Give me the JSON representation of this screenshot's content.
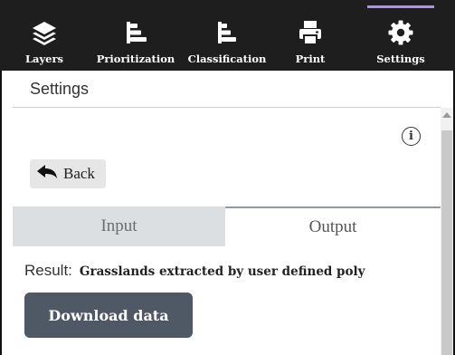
{
  "toolbar": {
    "items": [
      {
        "label": "Layers",
        "icon": "layers-icon"
      },
      {
        "label": "Prioritization",
        "icon": "prioritization-icon"
      },
      {
        "label": "Classification",
        "icon": "classification-icon"
      },
      {
        "label": "Print",
        "icon": "printer-icon"
      },
      {
        "label": "Settings",
        "icon": "gear-icon",
        "active": true
      }
    ],
    "background": "#1e1e1e",
    "active_indicator_color": "#a99bd0"
  },
  "panel": {
    "title": "Settings",
    "back_label": "Back",
    "info_icon": "info-icon"
  },
  "tabs": [
    {
      "label": "Input",
      "selected": false
    },
    {
      "label": "Output",
      "selected": true
    }
  ],
  "output": {
    "result_label": "Result:",
    "result_value": "Grasslands extracted by user defined poly",
    "download_label": "Download data",
    "button_color": "#4f5965"
  }
}
